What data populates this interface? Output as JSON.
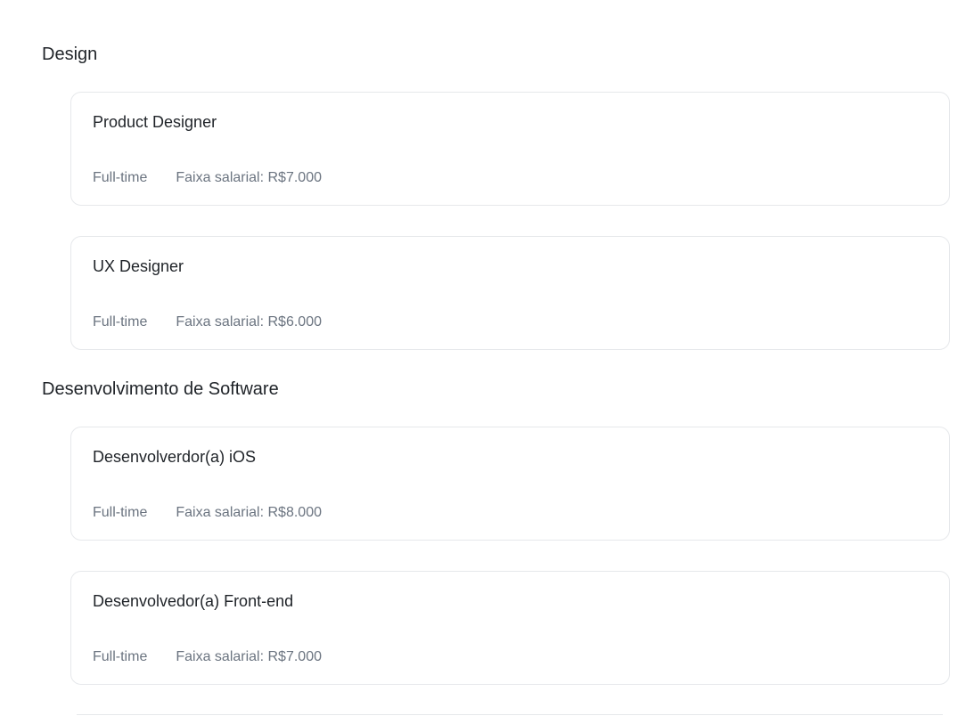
{
  "sections": [
    {
      "title": "Design",
      "jobs": [
        {
          "title": "Product Designer",
          "type": "Full-time",
          "salary": "Faixa salarial: R$7.000"
        },
        {
          "title": "UX Designer",
          "type": "Full-time",
          "salary": "Faixa salarial: R$6.000"
        }
      ]
    },
    {
      "title": "Desenvolvimento de Software",
      "jobs": [
        {
          "title": "Desenvolverdor(a) iOS",
          "type": "Full-time",
          "salary": "Faixa salarial: R$8.000"
        },
        {
          "title": "Desenvolvedor(a) Front-end",
          "type": "Full-time",
          "salary": "Faixa salarial: R$7.000"
        }
      ]
    }
  ]
}
